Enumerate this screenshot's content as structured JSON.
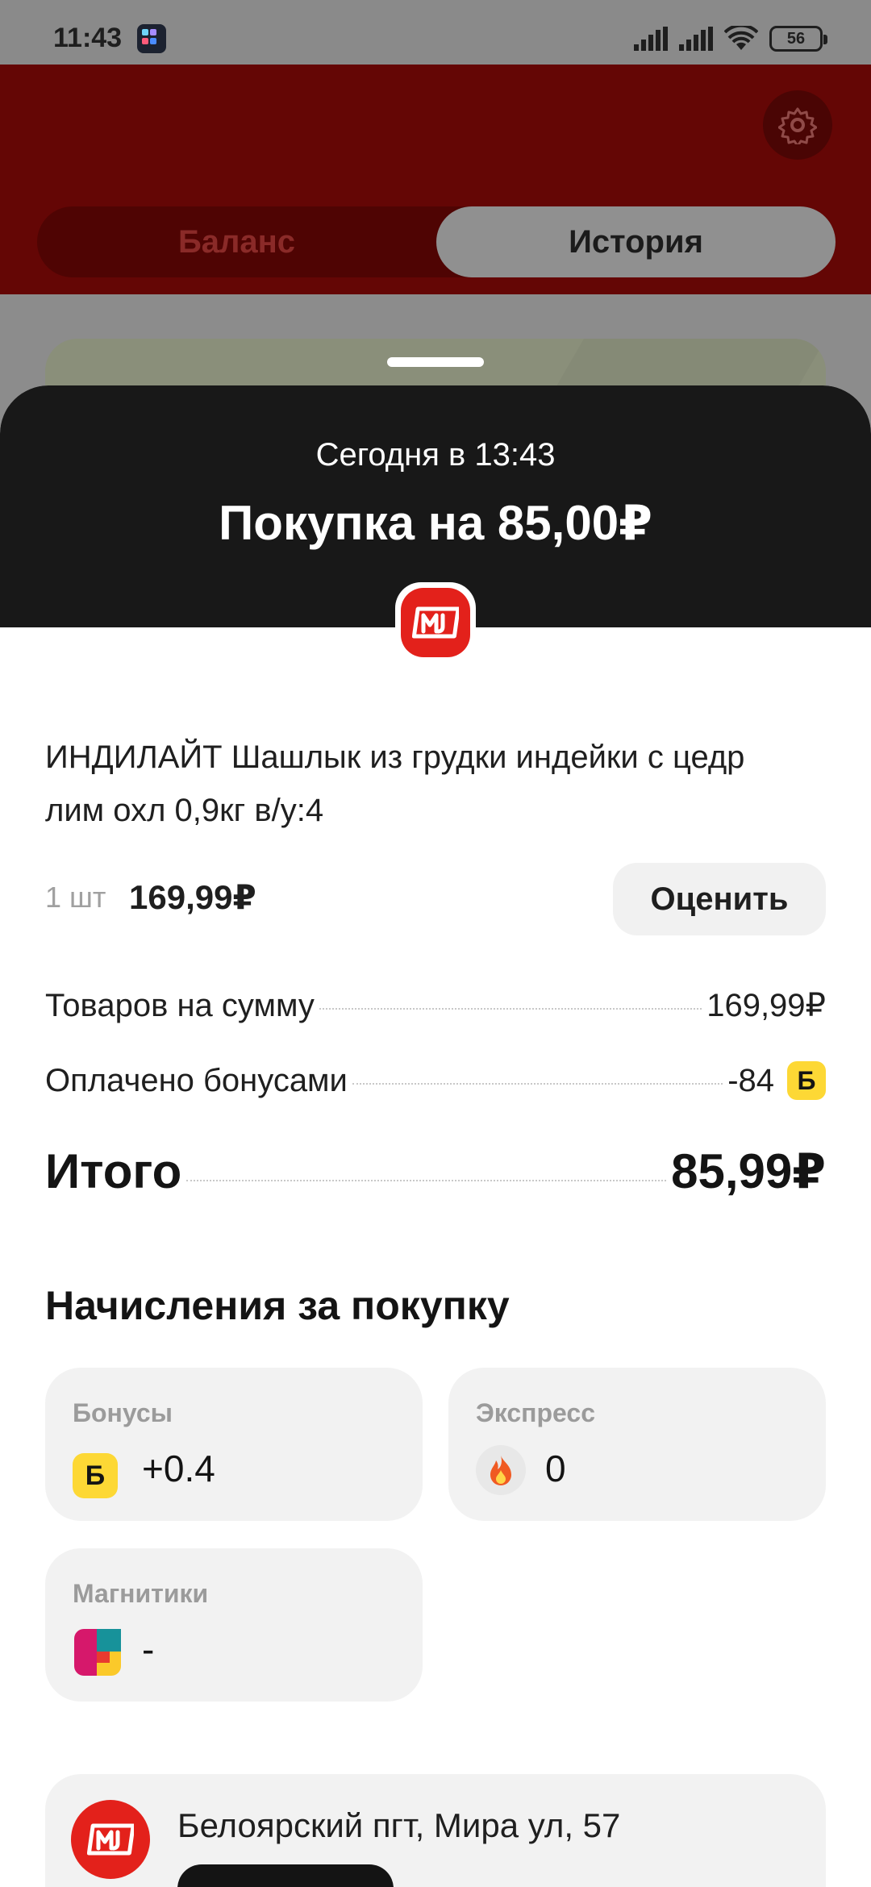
{
  "status_bar": {
    "time": "11:43",
    "battery": "56"
  },
  "header": {
    "tab_balance": "Баланс",
    "tab_history": "История",
    "active_tab": "История"
  },
  "sheet": {
    "date": "Сегодня в 13:43",
    "title": "Покупка на 85,00₽",
    "product": {
      "name": "ИНДИЛАЙТ Шашлык из грудки индейки с цедр лим охл 0,9кг в/у:4",
      "qty": "1 шт",
      "price": "169,99₽",
      "rate_label": "Оценить"
    },
    "summary": {
      "goods_label": "Товаров на сумму",
      "goods_value": "169,99₽",
      "bonus_label": "Оплачено бонусами",
      "bonus_value": "-84",
      "bonus_badge": "Б",
      "total_label": "Итого",
      "total_value": "85,99₽"
    },
    "accruals": {
      "title": "Начисления за покупку",
      "bonuses": {
        "label": "Бонусы",
        "badge": "Б",
        "value": "+0.4"
      },
      "express": {
        "label": "Экспресс",
        "value": "0"
      },
      "magnitiki": {
        "label": "Магнитики",
        "value": "-"
      }
    },
    "store": {
      "address": "Белоярский пгт, Мира ул, 57"
    }
  },
  "colors": {
    "brand_red": "#e3211b",
    "bonus_yellow": "#fdd835",
    "sheet_head": "#181818"
  }
}
